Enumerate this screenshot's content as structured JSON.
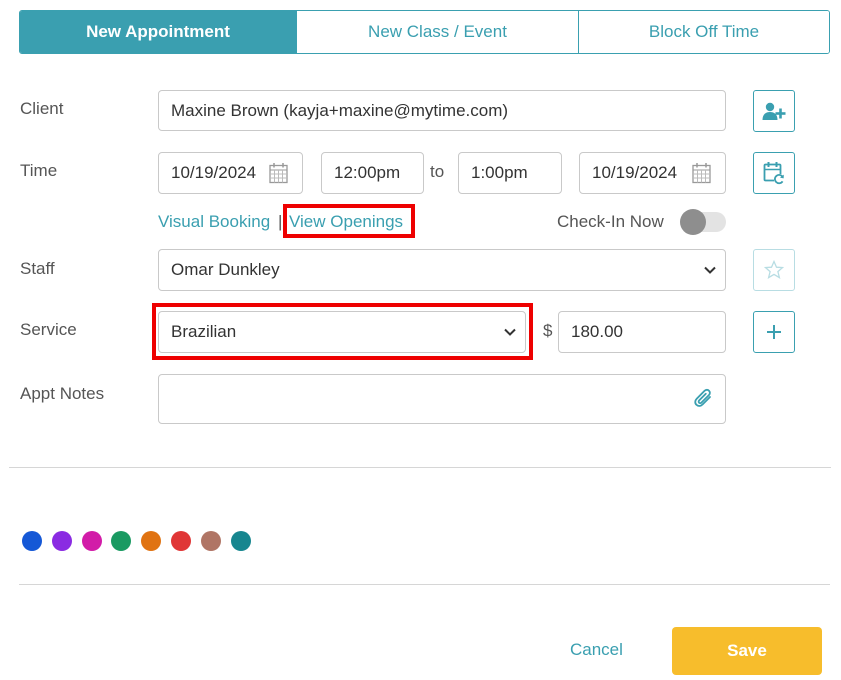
{
  "tabs": [
    {
      "label": "New Appointment",
      "active": true
    },
    {
      "label": "New Class / Event",
      "active": false
    },
    {
      "label": "Block Off Time",
      "active": false
    }
  ],
  "form": {
    "client_label": "Client",
    "client_value": "Maxine Brown (kayja+maxine@mytime.com)",
    "time_label": "Time",
    "start_date": "10/19/2024",
    "start_time": "12:00pm",
    "to_label": "to",
    "end_time": "1:00pm",
    "end_date": "10/19/2024",
    "visual_booking_label": "Visual Booking",
    "separator": "|",
    "view_openings_label": "View Openings",
    "checkin_label": "Check-In Now",
    "staff_label": "Staff",
    "staff_value": "Omar Dunkley",
    "service_label": "Service",
    "service_value": "Brazilian",
    "currency_symbol": "$",
    "price_value": "180.00",
    "notes_label": "Appt Notes",
    "notes_value": ""
  },
  "colors": [
    "#1558d6",
    "#8a2be2",
    "#d21ca8",
    "#1a9a62",
    "#e07312",
    "#e03636",
    "#b07565",
    "#17868f"
  ],
  "icons": {
    "add_client": "add-user-icon",
    "calendar": "calendar-icon",
    "recurring": "recurring-calendar-icon",
    "favorite": "star-icon",
    "add_service": "plus-icon",
    "attach": "paperclip-icon"
  },
  "footer": {
    "cancel_label": "Cancel",
    "save_label": "Save"
  }
}
